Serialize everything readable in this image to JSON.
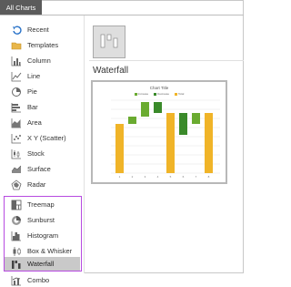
{
  "tab": {
    "label": "All Charts"
  },
  "sidebar": {
    "items": [
      {
        "label": "Recent",
        "icon": "recent-icon"
      },
      {
        "label": "Templates",
        "icon": "templates-icon"
      },
      {
        "label": "Column",
        "icon": "column-chart-icon"
      },
      {
        "label": "Line",
        "icon": "line-chart-icon"
      },
      {
        "label": "Pie",
        "icon": "pie-chart-icon"
      },
      {
        "label": "Bar",
        "icon": "bar-chart-icon"
      },
      {
        "label": "Area",
        "icon": "area-chart-icon"
      },
      {
        "label": "X Y (Scatter)",
        "icon": "scatter-chart-icon"
      },
      {
        "label": "Stock",
        "icon": "stock-chart-icon"
      },
      {
        "label": "Surface",
        "icon": "surface-chart-icon"
      },
      {
        "label": "Radar",
        "icon": "radar-chart-icon"
      },
      {
        "label": "Treemap",
        "icon": "treemap-chart-icon"
      },
      {
        "label": "Sunburst",
        "icon": "sunburst-chart-icon"
      },
      {
        "label": "Histogram",
        "icon": "histogram-chart-icon"
      },
      {
        "label": "Box & Whisker",
        "icon": "box-whisker-chart-icon"
      },
      {
        "label": "Waterfall",
        "icon": "waterfall-chart-icon",
        "selected": true
      },
      {
        "label": "Combo",
        "icon": "combo-chart-icon"
      }
    ]
  },
  "main": {
    "chart_name": "Waterfall",
    "preview": {
      "title": "Chart Title",
      "legend": [
        {
          "label": "Increase",
          "color": "#6aab30"
        },
        {
          "label": "Decrease",
          "color": "#3a8a2a"
        },
        {
          "label": "Total",
          "color": "#f0b428"
        }
      ]
    }
  },
  "colors": {
    "accent_highlight": "#b74be0",
    "selected_bg": "#c9c9c9",
    "tab_bg": "#5b5b5b",
    "total": "#f0b428",
    "increase": "#6aab30",
    "decrease": "#3a8a2a"
  }
}
